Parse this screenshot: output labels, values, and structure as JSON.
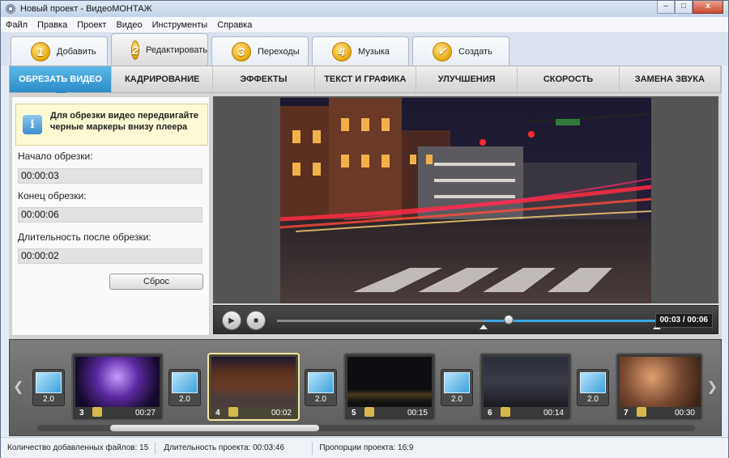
{
  "window": {
    "title": "Новый проект - ВидеоМОНТАЖ",
    "buttons": [
      "–",
      "□",
      "x"
    ]
  },
  "menu": [
    "Файл",
    "Правка",
    "Проект",
    "Видео",
    "Инструменты",
    "Справка"
  ],
  "steps": [
    {
      "num": "1",
      "label": "Добавить"
    },
    {
      "num": "2",
      "label": "Редактировать"
    },
    {
      "num": "3",
      "label": "Переходы"
    },
    {
      "num": "4",
      "label": "Музыка"
    },
    {
      "num": "✓",
      "label": "Создать"
    }
  ],
  "tabs": [
    "ОБРЕЗАТЬ ВИДЕО",
    "КАДРИРОВАНИЕ",
    "ЭФФЕКТЫ",
    "ТЕКСТ И ГРАФИКА",
    "УЛУЧШЕНИЯ",
    "СКОРОСТЬ",
    "ЗАМЕНА ЗВУКА"
  ],
  "trim": {
    "info": "Для обрезки видео передвигайте черные маркеры внизу плеера",
    "start_label": "Начало обрезки:",
    "start_value": "00:00:03",
    "end_label": "Конец обрезки:",
    "end_value": "00:00:06",
    "duration_label": "Длительность после обрезки:",
    "duration_value": "00:00:02",
    "reset_label": "Сброс"
  },
  "player": {
    "timecode": "00:03 / 00:06",
    "progress": 0.5
  },
  "timeline": {
    "clips": [
      {
        "num": "3",
        "time": "00:27"
      },
      {
        "num": "4",
        "time": "00:02"
      },
      {
        "num": "5",
        "time": "00:15"
      },
      {
        "num": "6",
        "time": "00:14"
      },
      {
        "num": "7",
        "time": "00:30"
      }
    ],
    "transitions": [
      "2.0",
      "2.0",
      "2.0",
      "2.0",
      "2.0"
    ]
  },
  "status": {
    "files": "Количество добавленных файлов: 15",
    "duration": "Длительность проекта: 00:03:46",
    "ratio": "Пропорции проекта: 16:9"
  }
}
